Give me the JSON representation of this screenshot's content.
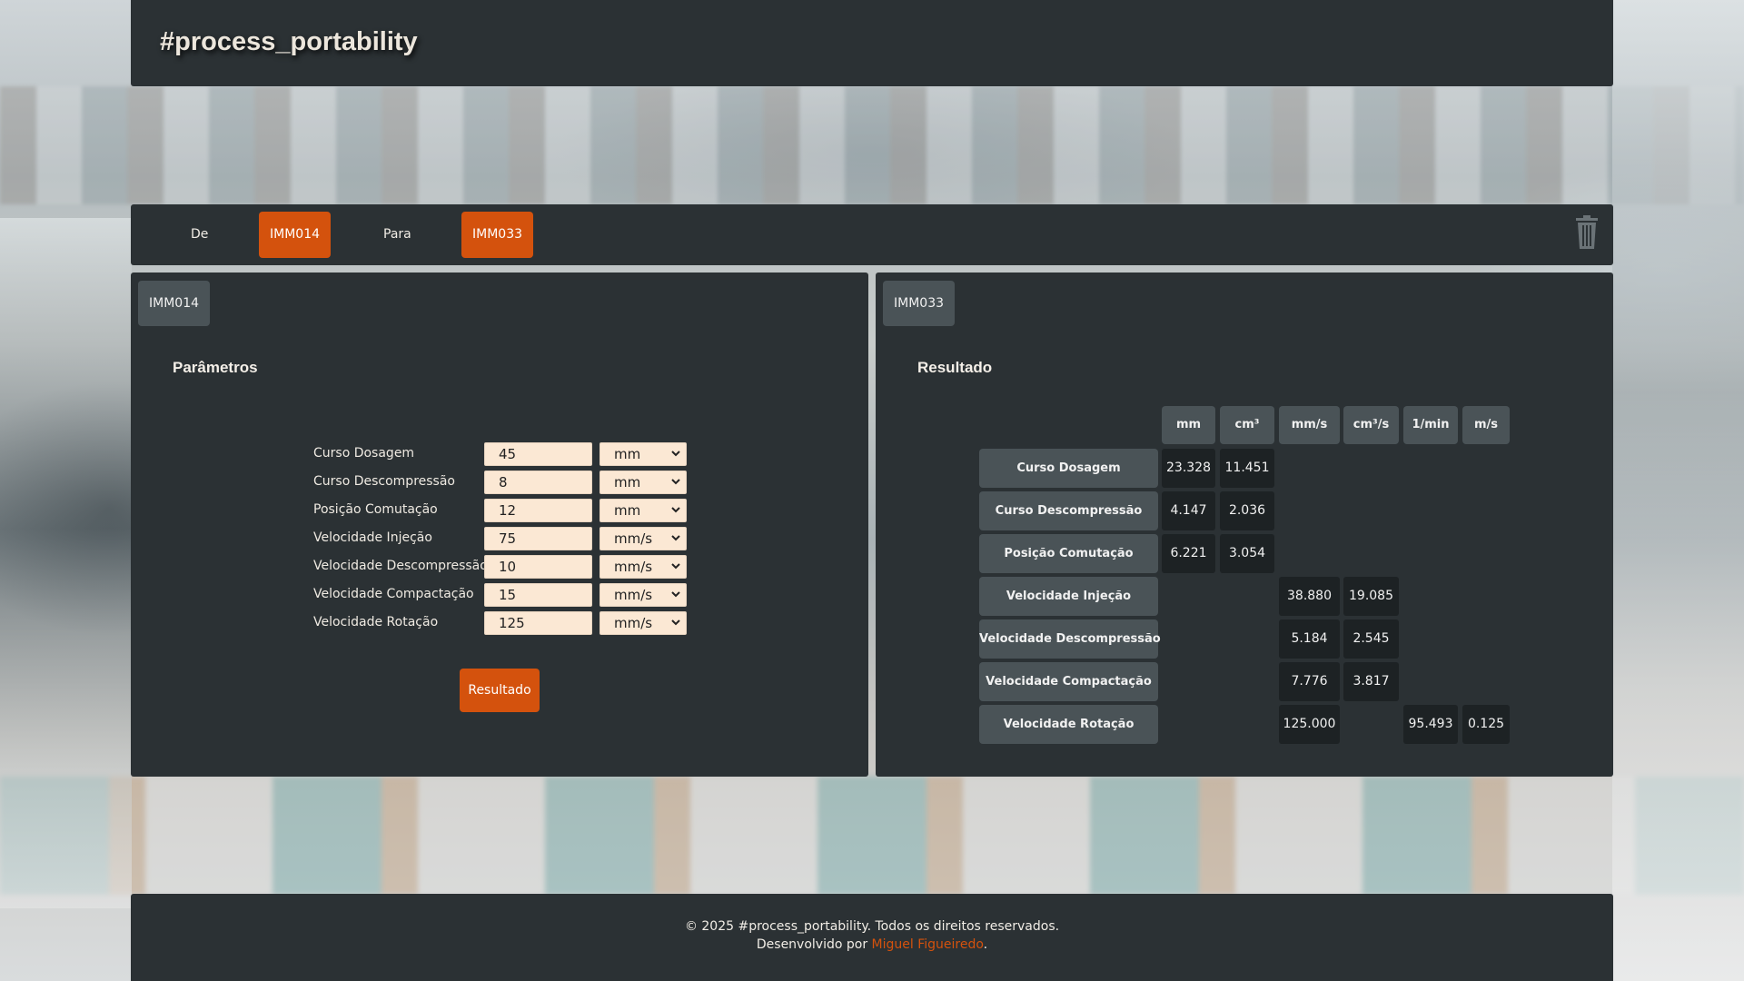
{
  "header": {
    "title": "#process_portability"
  },
  "selector": {
    "from_label": "De",
    "from_machine": "IMM014",
    "to_label": "Para",
    "to_machine": "IMM033"
  },
  "left": {
    "machine": "IMM014",
    "section_title": "Parâmetros",
    "params": [
      {
        "label": "Curso Dosagem",
        "value": "45",
        "unit": "mm"
      },
      {
        "label": "Curso Descompressão",
        "value": "8",
        "unit": "mm"
      },
      {
        "label": "Posição Comutação",
        "value": "12",
        "unit": "mm"
      },
      {
        "label": "Velocidade Injeção",
        "value": "75",
        "unit": "mm/s"
      },
      {
        "label": "Velocidade Descompressão",
        "value": "10",
        "unit": "mm/s"
      },
      {
        "label": "Velocidade Compactação",
        "value": "15",
        "unit": "mm/s"
      },
      {
        "label": "Velocidade Rotação",
        "value": "125",
        "unit": "mm/s"
      }
    ],
    "result_button": "Resultado"
  },
  "right": {
    "machine": "IMM033",
    "section_title": "Resultado",
    "unit_headers": [
      "mm",
      "cm³",
      "mm/s",
      "cm³/s",
      "1/min",
      "m/s"
    ],
    "rows": [
      {
        "label": "Curso Dosagem",
        "values": [
          "23.328",
          "11.451",
          "",
          "",
          "",
          ""
        ]
      },
      {
        "label": "Curso Descompressão",
        "values": [
          "4.147",
          "2.036",
          "",
          "",
          "",
          ""
        ]
      },
      {
        "label": "Posição Comutação",
        "values": [
          "6.221",
          "3.054",
          "",
          "",
          "",
          ""
        ]
      },
      {
        "label": "Velocidade Injeção",
        "values": [
          "",
          "",
          "38.880",
          "19.085",
          "",
          ""
        ]
      },
      {
        "label": "Velocidade Descompressão",
        "values": [
          "",
          "",
          "5.184",
          "2.545",
          "",
          ""
        ]
      },
      {
        "label": "Velocidade Compactação",
        "values": [
          "",
          "",
          "7.776",
          "3.817",
          "",
          ""
        ]
      },
      {
        "label": "Velocidade Rotação",
        "values": [
          "",
          "",
          "125.000",
          "",
          "95.493",
          "0.125"
        ]
      }
    ]
  },
  "footer": {
    "copyright": "© 2025 #process_portability. Todos os direitos reservados.",
    "developed_prefix": "Desenvolvido por ",
    "developer": "Miguel Figueiredo",
    "developed_suffix": "."
  },
  "colors": {
    "panel": "#2b3134",
    "accent": "#d4520d",
    "chip": "#4a5357",
    "input_bg": "#fbe8d4"
  }
}
